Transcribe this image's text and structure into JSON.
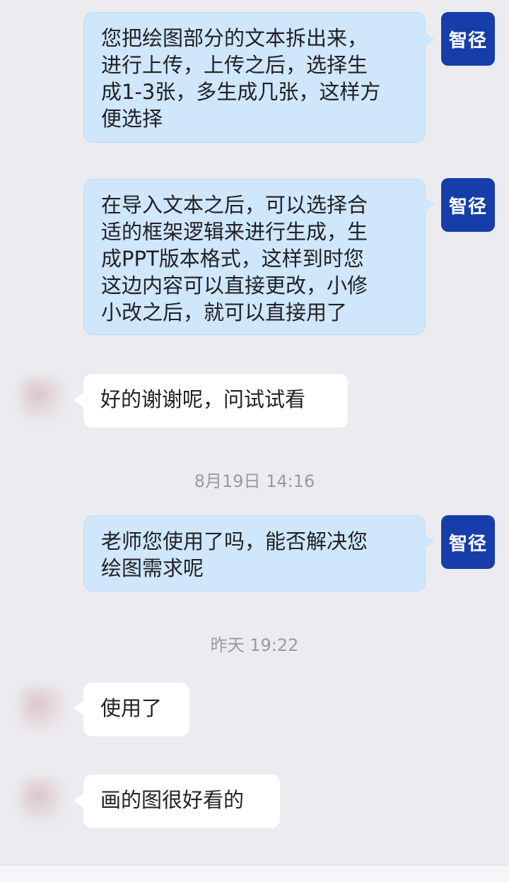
{
  "chat": {
    "messages": [
      {
        "side": "right",
        "avatar_label": "智径",
        "lines": [
          "您把绘图部分的文本拆出来，",
          "进行上传，上传之后，选择生",
          "成1-3张，多生成几张，这样方",
          "便选择"
        ]
      },
      {
        "side": "right",
        "avatar_label": "智径",
        "lines": [
          "在导入文本之后，可以选择合",
          "适的框架逻辑来进行生成，生",
          "成PPT版本格式，这样到时您",
          "这边内容可以直接更改，小修",
          "小改之后，就可以直接用了"
        ]
      },
      {
        "side": "left",
        "lines": [
          "好的谢谢呢，问试试看"
        ]
      },
      {
        "type": "timestamp",
        "text": "8月19日 14:16"
      },
      {
        "side": "right",
        "avatar_label": "智径",
        "lines": [
          "老师您使用了吗，能否解决您",
          "绘图需求呢"
        ]
      },
      {
        "type": "timestamp",
        "text": "昨天 19:22"
      },
      {
        "side": "left",
        "lines": [
          "使用了"
        ]
      },
      {
        "side": "left",
        "lines": [
          "画的图很好看的"
        ]
      }
    ]
  },
  "colors": {
    "background": "#ebebf0",
    "right_bubble": "#cfe6fb",
    "left_bubble": "#ffffff",
    "brand_avatar": "#163da9",
    "timestamp_text": "#9a9aa2"
  }
}
